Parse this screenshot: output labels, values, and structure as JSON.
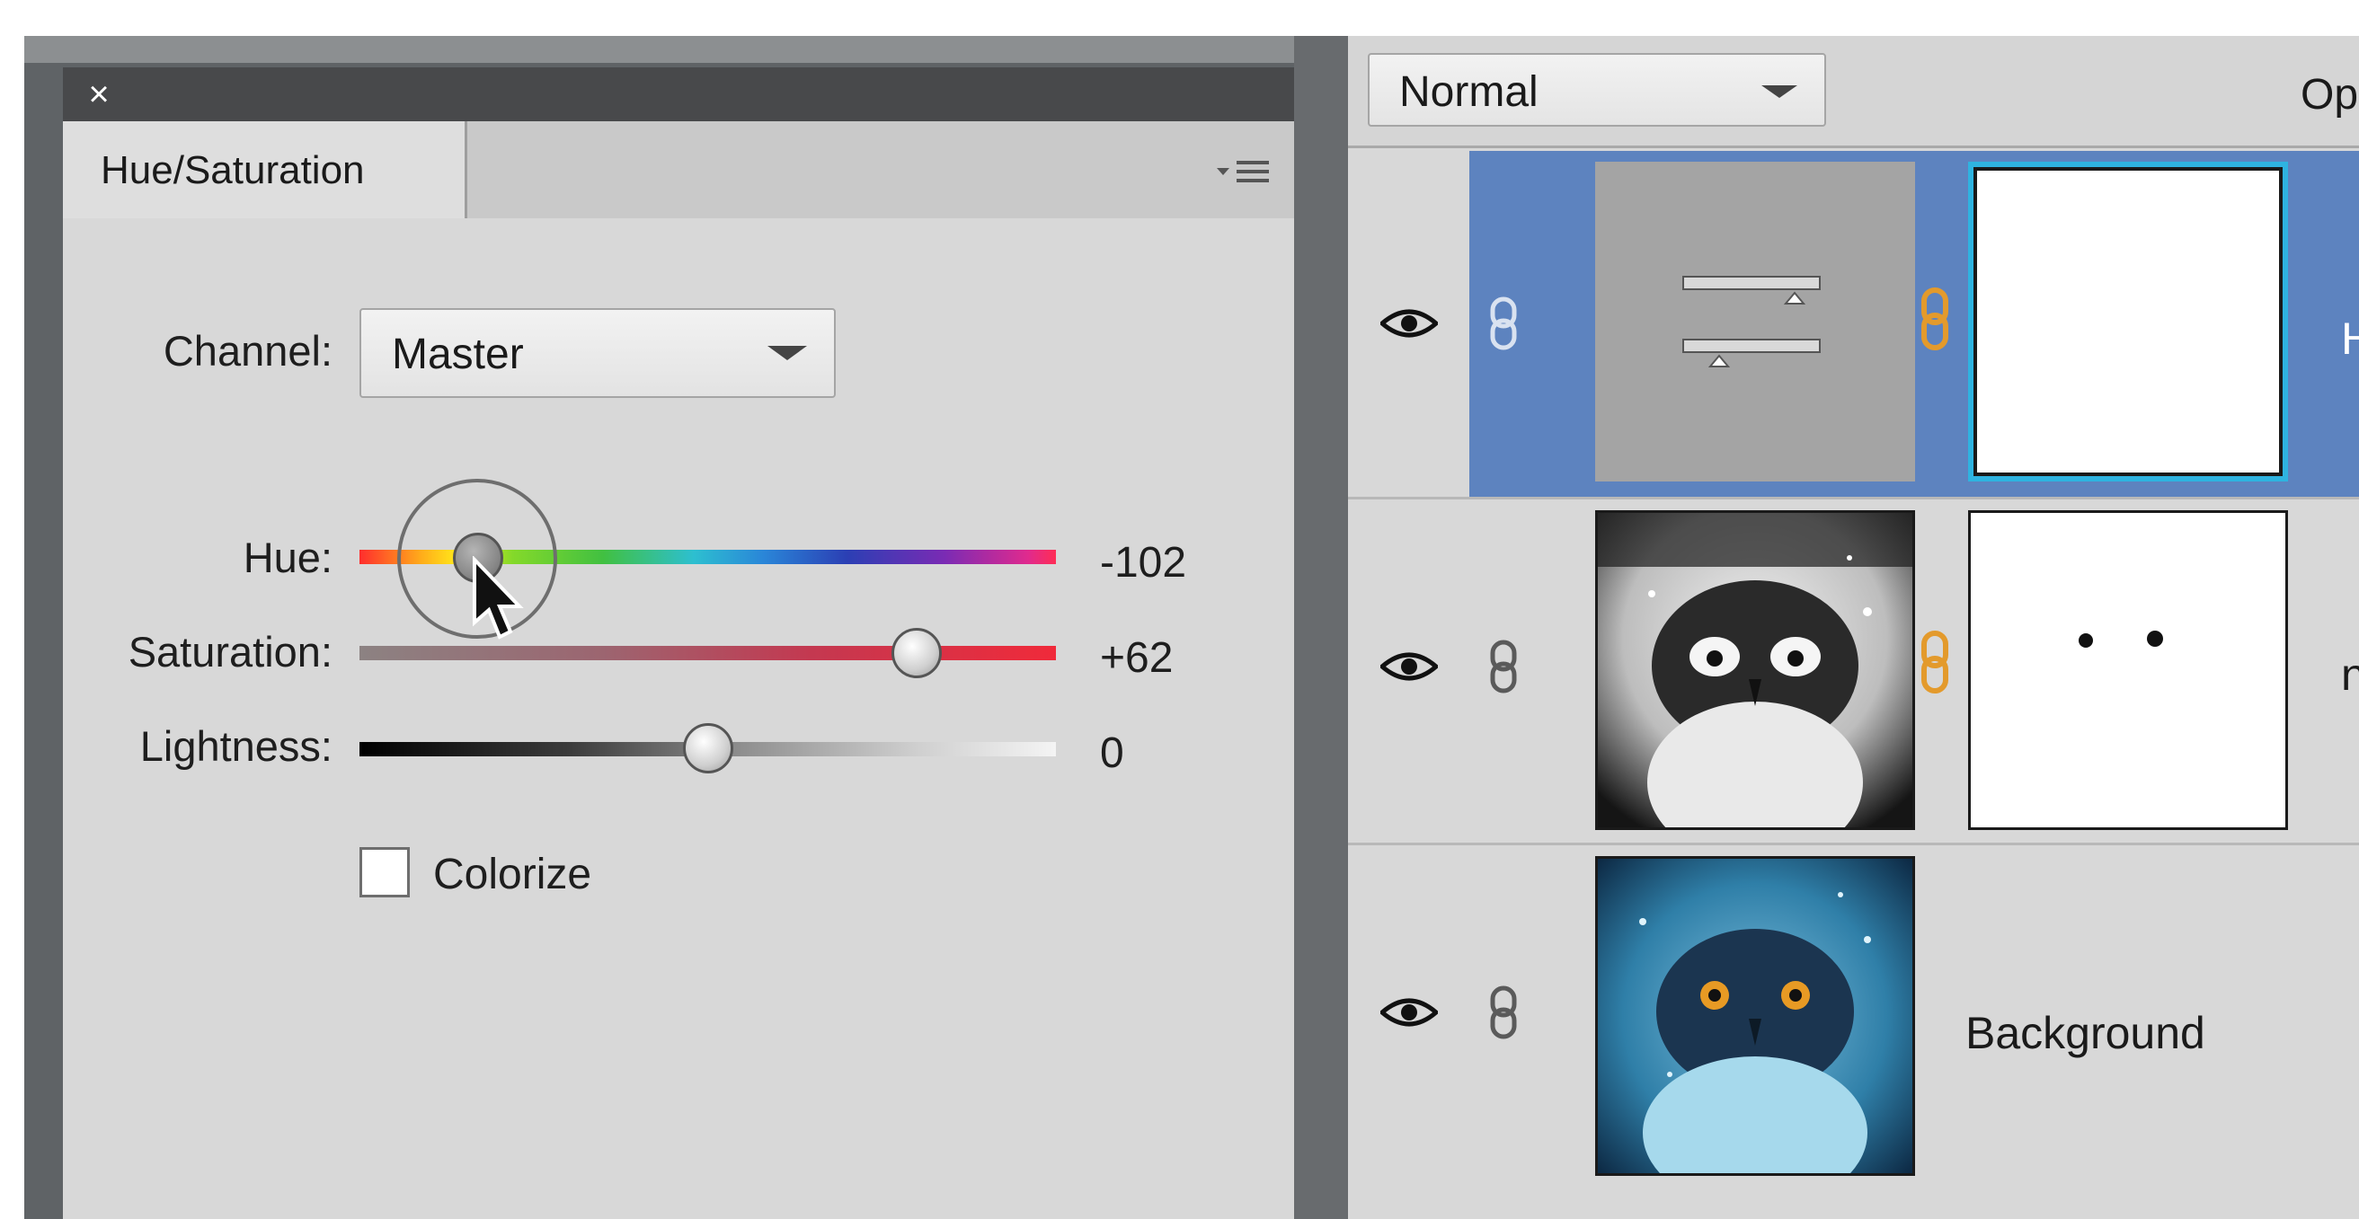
{
  "adjustment_panel": {
    "close_glyph": "×",
    "tab_label": "Hue/Saturation",
    "channel": {
      "label": "Channel:",
      "value": "Master"
    },
    "sliders": {
      "hue": {
        "label": "Hue:",
        "value": "-102",
        "position_fraction": 0.18
      },
      "saturation": {
        "label": "Saturation:",
        "value": "+62",
        "position_fraction": 0.8
      },
      "lightness": {
        "label": "Lightness:",
        "value": "0",
        "position_fraction": 0.5
      }
    },
    "colorize": {
      "label": "Colorize",
      "checked": false
    }
  },
  "layers_panel": {
    "blend_mode": "Normal",
    "opacity_label": "Op",
    "layers": [
      {
        "type": "hue-saturation-adjustment",
        "selected": true,
        "visible": true,
        "name_fragment": "H"
      },
      {
        "type": "pixel-with-mask",
        "selected": false,
        "visible": true,
        "name_fragment": "n"
      },
      {
        "type": "pixel",
        "selected": false,
        "visible": true,
        "name": "Background"
      }
    ]
  },
  "colors": {
    "selected_row": "#5d83bf",
    "mask_highlight": "#2fb3e0",
    "chain_link": "#e39a2c",
    "panel_bg": "#d8d8d8",
    "titlebar": "#48494b"
  }
}
